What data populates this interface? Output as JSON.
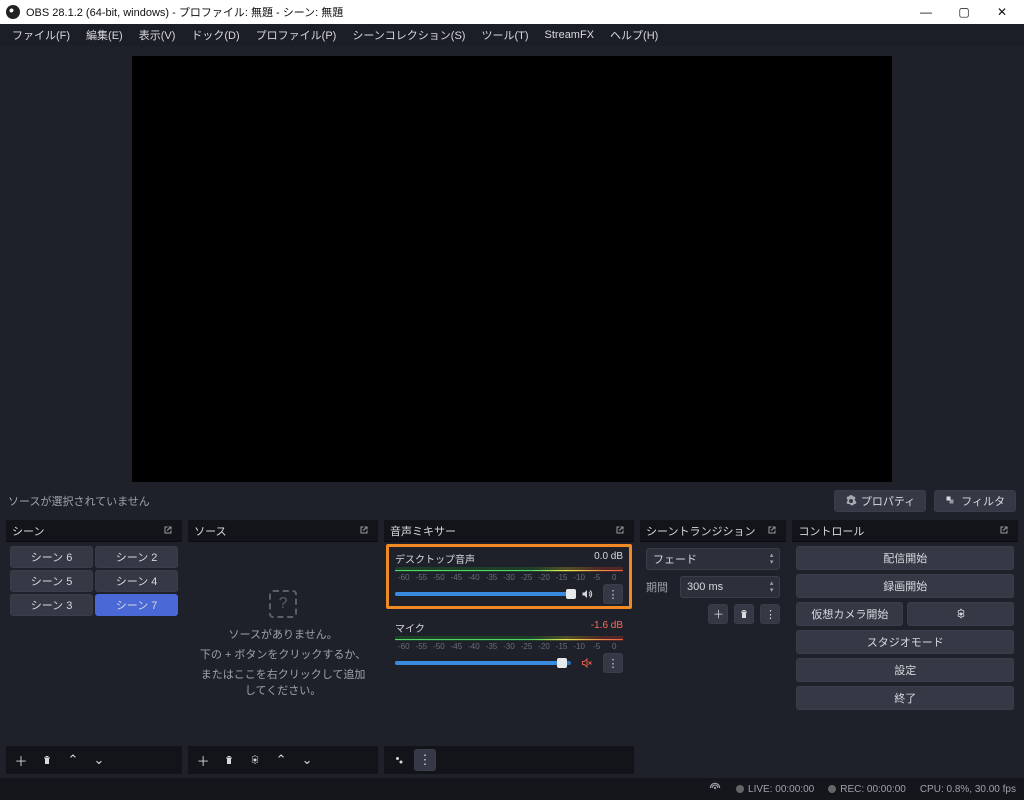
{
  "window": {
    "title": "OBS 28.1.2 (64-bit, windows) - プロファイル: 無題 - シーン: 無題"
  },
  "menu": {
    "file": "ファイル(F)",
    "edit": "編集(E)",
    "view": "表示(V)",
    "dock": "ドック(D)",
    "profile": "プロファイル(P)",
    "scene_collection": "シーンコレクション(S)",
    "tools": "ツール(T)",
    "streamfx": "StreamFX",
    "help": "ヘルプ(H)"
  },
  "toolbar": {
    "no_source": "ソースが選択されていません",
    "properties": "プロパティ",
    "filters": "フィルタ"
  },
  "panels": {
    "scenes": "シーン",
    "sources": "ソース",
    "mixer": "音声ミキサー",
    "transitions": "シーントランジション",
    "controls": "コントロール"
  },
  "scenes": {
    "items": [
      {
        "label": "シーン 6"
      },
      {
        "label": "シーン 2"
      },
      {
        "label": "シーン 5"
      },
      {
        "label": "シーン 4"
      },
      {
        "label": "シーン 3"
      },
      {
        "label": "シーン 7",
        "selected": true
      }
    ]
  },
  "sources": {
    "empty_title": "ソースがありません。",
    "empty_line1": "下の + ボタンをクリックするか、",
    "empty_line2": "またはここを右クリックして追加してください。"
  },
  "mixer": {
    "ticks": [
      "-60",
      "-55",
      "-50",
      "-45",
      "-40",
      "-35",
      "-30",
      "-25",
      "-20",
      "-15",
      "-10",
      "-5",
      "0"
    ],
    "channels": [
      {
        "name": "デスクトップ音声",
        "db": "0.0 dB",
        "fill": 100,
        "thumb": 100,
        "highlight": true,
        "muted": false
      },
      {
        "name": "マイク",
        "db": "-1.6 dB",
        "fill": 95,
        "thumb": 95,
        "highlight": false,
        "muted": true
      }
    ]
  },
  "transitions": {
    "type": "フェード",
    "duration_label": "期間",
    "duration_value": "300 ms"
  },
  "controls": {
    "stream": "配信開始",
    "record": "録画開始",
    "vcam": "仮想カメラ開始",
    "studio": "スタジオモード",
    "settings": "設定",
    "exit": "終了"
  },
  "status": {
    "live": "LIVE: 00:00:00",
    "rec": "REC: 00:00:00",
    "cpu": "CPU: 0.8%, 30.00 fps"
  }
}
